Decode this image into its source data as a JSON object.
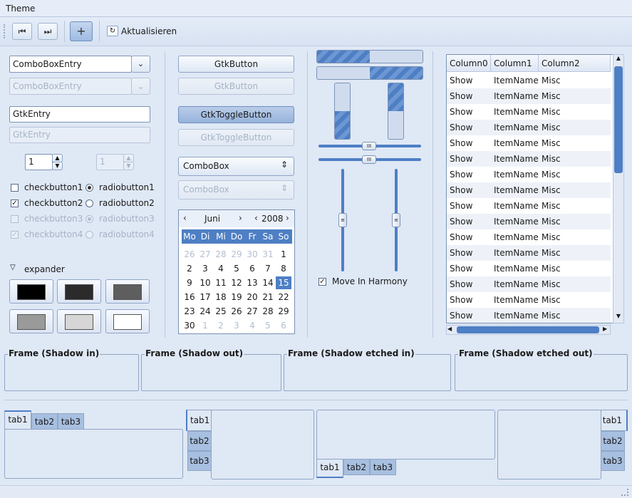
{
  "menu": {
    "theme": "Theme"
  },
  "toolbar": {
    "first_icon": "⏮",
    "last_icon": "⏭",
    "add_icon": "+",
    "refresh_icon": "↻",
    "refresh_label": "Aktualisieren"
  },
  "col1": {
    "combo_entry": "ComboBoxEntry",
    "combo_entry_disabled": "ComboBoxEntry",
    "entry": "GtkEntry",
    "entry_disabled": "GtkEntry",
    "spin_value": "1",
    "spin_disabled_value": "1",
    "checkbuttons": [
      "checkbutton1",
      "checkbutton2",
      "checkbutton3",
      "checkbutton4"
    ],
    "radiobuttons": [
      "radiobutton1",
      "radiobutton2",
      "radiobutton3",
      "radiobutton4"
    ],
    "expander": "expander",
    "swatch_colors": [
      "#000000",
      "#2b2b2b",
      "#5e5e5e",
      "#9a9a9a",
      "#d6d6d6",
      "#ffffff"
    ]
  },
  "col2": {
    "button": "GtkButton",
    "button_disabled": "GtkButton",
    "toggle": "GtkToggleButton",
    "toggle_disabled": "GtkToggleButton",
    "combo": "ComboBox",
    "combo_disabled": "ComboBox",
    "calendar": {
      "month": "Juni",
      "year": "2008",
      "weekdays": [
        "Mo",
        "Di",
        "Mi",
        "Do",
        "Fr",
        "Sa",
        "So"
      ],
      "rows": [
        [
          "26",
          "27",
          "28",
          "29",
          "30",
          "31",
          "1"
        ],
        [
          "2",
          "3",
          "4",
          "5",
          "6",
          "7",
          "8"
        ],
        [
          "9",
          "10",
          "11",
          "12",
          "13",
          "14",
          "15"
        ],
        [
          "16",
          "17",
          "18",
          "19",
          "20",
          "21",
          "22"
        ],
        [
          "23",
          "24",
          "25",
          "26",
          "27",
          "28",
          "29"
        ],
        [
          "30",
          "1",
          "2",
          "3",
          "4",
          "5",
          "6"
        ]
      ],
      "selected": "15"
    }
  },
  "col3": {
    "progress": [
      0.5,
      0.5
    ],
    "vprogress": [
      0.5,
      0.5
    ],
    "move_in_harmony": "Move In Harmony",
    "scale_handle": "III"
  },
  "tree": {
    "columns": [
      "Column0",
      "Column1",
      "Column2"
    ],
    "row": [
      "Show",
      "ItemName",
      "Misc"
    ],
    "row_count": 16
  },
  "frames": [
    "Frame (Shadow in)",
    "Frame (Shadow out)",
    "Frame (Shadow etched in)",
    "Frame (Shadow etched out)"
  ],
  "tabs": [
    "tab1",
    "tab2",
    "tab3"
  ]
}
